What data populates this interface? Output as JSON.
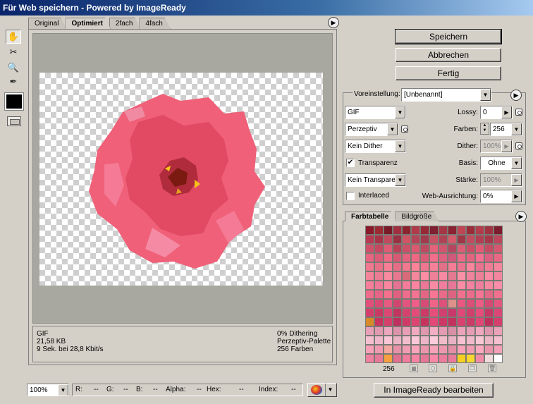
{
  "window": {
    "title": "Für Web speichern - Powered by ImageReady"
  },
  "tools": [
    {
      "name": "hand-tool",
      "icon": "hand-icon",
      "glyph": "✋",
      "active": true
    },
    {
      "name": "slice-select-tool",
      "icon": "slice-select-icon",
      "glyph": "✂",
      "active": false
    },
    {
      "name": "zoom-tool",
      "icon": "magnifier-icon",
      "glyph": "🔍",
      "active": false
    },
    {
      "name": "eyedropper-tool",
      "icon": "eyedropper-icon",
      "glyph": "✒",
      "active": false
    }
  ],
  "tabs": [
    {
      "label": "Original",
      "active": false
    },
    {
      "label": "Optimiert",
      "active": true
    },
    {
      "label": "2fach",
      "active": false
    },
    {
      "label": "4fach",
      "active": false
    }
  ],
  "info": {
    "format": "GIF",
    "size": "21,58 KB",
    "speed": "9 Sek. bei 28,8 Kbit/s",
    "dithering": "0% Dithering",
    "palette": "Perzeptiv-Palette",
    "colors": "256 Farben"
  },
  "buttons": {
    "save": "Speichern",
    "cancel": "Abbrechen",
    "done": "Fertig"
  },
  "settings": {
    "preset_label": "Voreinstellung:",
    "preset_value": "[Unbenannt]",
    "format": "GIF",
    "reduction": "Perzeptiv",
    "dither": "Kein Dither",
    "transparency_label": "Transparenz",
    "transparency_checked": true,
    "matte_dither": "Kein Transpare...",
    "interlaced_label": "Interlaced",
    "interlaced_checked": false,
    "lossy_label": "Lossy:",
    "lossy_value": "0",
    "colors_label": "Farben:",
    "colors_value": "256",
    "dither_amount_label": "Dither:",
    "dither_amount_value": "100%",
    "matte_label": "Basis:",
    "matte_value": "Ohne",
    "amount_label": "Stärke:",
    "amount_value": "100%",
    "websnap_label": "Web-Ausrichtung:",
    "websnap_value": "0%"
  },
  "color_table": {
    "tabs": [
      {
        "label": "Farbtabelle",
        "active": true
      },
      {
        "label": "Bildgröße",
        "active": false
      }
    ],
    "count": "256",
    "colors": [
      "#8a1a2a",
      "#9c2a32",
      "#7a1a28",
      "#a03040",
      "#8c2430",
      "#b03a4a",
      "#962838",
      "#7e2030",
      "#a43646",
      "#8a2232",
      "#c04454",
      "#9a2c3a",
      "#b23c4c",
      "#a03242",
      "#7c1c2c",
      "#b83a52",
      "#a8344a",
      "#c24a5e",
      "#9a3044",
      "#d05466",
      "#b44458",
      "#a03a4c",
      "#c65264",
      "#b04256",
      "#d45a6c",
      "#9e3646",
      "#c04c5e",
      "#b23e52",
      "#a6384a",
      "#bc465a",
      "#d0506a",
      "#c44862",
      "#e05c76",
      "#b84258",
      "#cc5068",
      "#da5870",
      "#c04a62",
      "#e4627a",
      "#d25670",
      "#b64660",
      "#dc5e76",
      "#ca4e66",
      "#e25a74",
      "#c64c64",
      "#d45870",
      "#e86480",
      "#dc5c78",
      "#f06a86",
      "#d65a74",
      "#e4627e",
      "#ee6884",
      "#da5c76",
      "#f26e8a",
      "#e06080",
      "#d0587a",
      "#ec6a86",
      "#e2647e",
      "#f47090",
      "#de6080",
      "#ea6884",
      "#f07890",
      "#e87088",
      "#f87e96",
      "#e46e86",
      "#f2788e",
      "#fc8298",
      "#ee7690",
      "#f6809a",
      "#e27088",
      "#f47c94",
      "#ec7490",
      "#fa849c",
      "#e87290",
      "#f07c96",
      "#f6869e",
      "#f48298",
      "#ec7c94",
      "#fa8aa0",
      "#e87890",
      "#d86a7a",
      "#f4869c",
      "#fc8ea4",
      "#ee8098",
      "#f68aa2",
      "#e47a92",
      "#fa90a6",
      "#f0849c",
      "#ec8098",
      "#f88ca4",
      "#f2869e",
      "#f67e9a",
      "#ee7896",
      "#fc86a0",
      "#e47292",
      "#f47c9a",
      "#fa84a0",
      "#ea7896",
      "#f88aa4",
      "#f07e9c",
      "#e8769a",
      "#fc8ca6",
      "#f2829e",
      "#ee7e9c",
      "#f688a2",
      "#fa8ea8",
      "#f06a8a",
      "#e86486",
      "#f6708e",
      "#e06080",
      "#ee6c8c",
      "#f47292",
      "#e46684",
      "#f87694",
      "#ea6a8a",
      "#de6282",
      "#f2708e",
      "#ec6a8c",
      "#f67494",
      "#e46888",
      "#f0708e",
      "#e0507a",
      "#d84a74",
      "#e85a82",
      "#d04670",
      "#e45480",
      "#ee5e88",
      "#d64c76",
      "#f06488",
      "#dc527c",
      "#e0908a",
      "#e85880",
      "#da4e78",
      "#ec5c84",
      "#d44a74",
      "#e25680",
      "#d43e6c",
      "#ca3866",
      "#de4674",
      "#c23462",
      "#d64270",
      "#e44c7a",
      "#cc3a68",
      "#e84e7c",
      "#d04070",
      "#c8386a",
      "#e0487a",
      "#d23e6e",
      "#e64c7c",
      "#c63868",
      "#dc4676",
      "#d88a2a",
      "#c83460",
      "#d63e6c",
      "#be3060",
      "#d03a68",
      "#de4472",
      "#c6345e",
      "#e2487a",
      "#cc3868",
      "#c2325e",
      "#da4070",
      "#cc3a68",
      "#e04676",
      "#c0305e",
      "#d63e6e",
      "#e8a0b8",
      "#e29ab2",
      "#eca6be",
      "#dc94ac",
      "#e89eb6",
      "#f0aac2",
      "#e098b0",
      "#f2aec4",
      "#e49cb4",
      "#d890a8",
      "#eca4bc",
      "#e69eb6",
      "#f0a8c0",
      "#de96ae",
      "#eaa2ba",
      "#f4c0d0",
      "#eeb8ca",
      "#f8c6d6",
      "#eab4c6",
      "#f2bece",
      "#fac8d8",
      "#ecb6c8",
      "#fcccdc",
      "#f0bccc",
      "#e8b2c4",
      "#f6c2d2",
      "#f0bacc",
      "#f8c8d6",
      "#ecb8c8",
      "#f4c0d0",
      "#f8a0b8",
      "#f09ab2",
      "#f4a8a0",
      "#e890a8",
      "#f29cb4",
      "#fba4bc",
      "#ec96ae",
      "#f6a2b8",
      "#ee98b0",
      "#e48ea6",
      "#f8a2ba",
      "#f09cb4",
      "#fca8c0",
      "#ea94ac",
      "#f4a0b8",
      "#f080a0",
      "#e87898",
      "#f6a040",
      "#e07090",
      "#f07c9c",
      "#f884a4",
      "#e67696",
      "#fa88a6",
      "#ec7c9c",
      "#ea7a9a",
      "#f6d020",
      "#f8d830",
      "#f08ca6",
      "#eedcdc",
      "#ffffff"
    ]
  },
  "status": {
    "zoom": "100%",
    "r_label": "R:",
    "r_value": "--",
    "g_label": "G:",
    "g_value": "--",
    "b_label": "B:",
    "b_value": "--",
    "alpha_label": "Alpha:",
    "alpha_value": "--",
    "hex_label": "Hex:",
    "hex_value": "--",
    "index_label": "Index:",
    "index_value": "--"
  },
  "edit_button": "In ImageReady bearbeiten"
}
